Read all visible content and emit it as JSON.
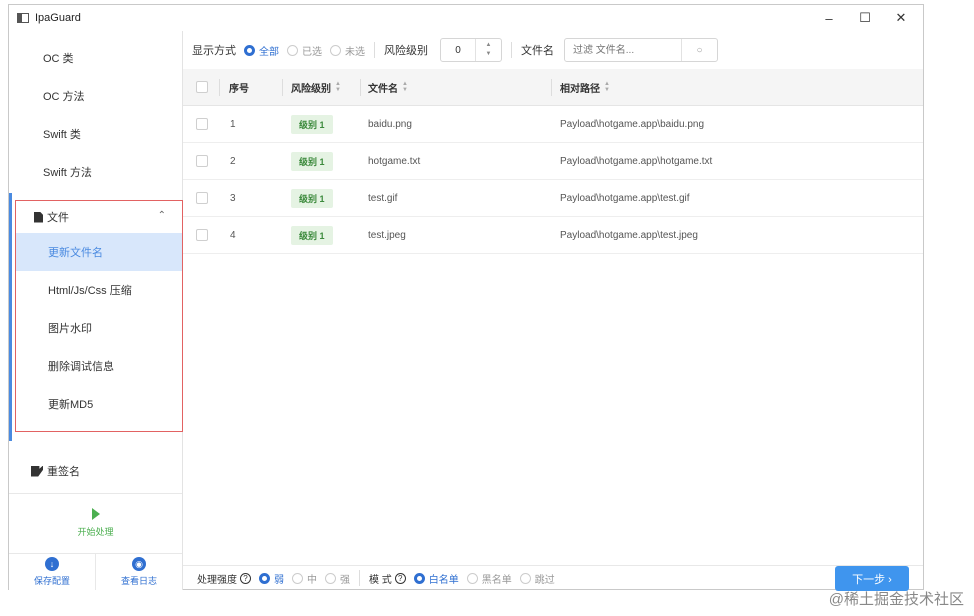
{
  "window": {
    "title": "IpaGuard",
    "min": "–",
    "max": "☐",
    "close": "✕"
  },
  "sidebar": {
    "items": [
      {
        "label": "OC 类"
      },
      {
        "label": "OC 方法"
      },
      {
        "label": "Swift 类"
      },
      {
        "label": "Swift 方法"
      }
    ],
    "group": {
      "label": "文件",
      "chevron": "⌃",
      "subitems": [
        {
          "label": "更新文件名",
          "active": true
        },
        {
          "label": "Html/Js/Css 压缩"
        },
        {
          "label": "图片水印"
        },
        {
          "label": "删除调试信息"
        },
        {
          "label": "更新MD5"
        }
      ]
    },
    "resign": "重签名",
    "start": "开始处理",
    "save_config": "保存配置",
    "view_log": "查看日志"
  },
  "toolbar": {
    "display_mode": "显示方式",
    "options": [
      "全部",
      "已选",
      "未选"
    ],
    "selected": "全部",
    "risk_level": "风险级别",
    "risk_value": "0",
    "filename_label": "文件名",
    "search_placeholder": "过滤 文件名..."
  },
  "table": {
    "headers": [
      "序号",
      "风险级别",
      "文件名",
      "相对路径"
    ],
    "rows": [
      {
        "index": "1",
        "risk": "级别 1",
        "name": "baidu.png",
        "path": "Payload\\hotgame.app\\baidu.png"
      },
      {
        "index": "2",
        "risk": "级别 1",
        "name": "hotgame.txt",
        "path": "Payload\\hotgame.app\\hotgame.txt"
      },
      {
        "index": "3",
        "risk": "级别 1",
        "name": "test.gif",
        "path": "Payload\\hotgame.app\\test.gif"
      },
      {
        "index": "4",
        "risk": "级别 1",
        "name": "test.jpeg",
        "path": "Payload\\hotgame.app\\test.jpeg"
      }
    ]
  },
  "footer": {
    "strength_label": "处理强度",
    "strength_options": [
      "弱",
      "中",
      "强"
    ],
    "strength_selected": "弱",
    "mode_label": "模 式",
    "mode_options": [
      "白名单",
      "黑名单",
      "跳过"
    ],
    "mode_selected": "白名单",
    "next": "下一步 ›"
  },
  "watermark": "@稀土掘金技术社区",
  "colors": {
    "accent": "#2f6fd1",
    "next_button": "#3f95ee",
    "start": "#4caf50",
    "group_border": "#e26262"
  }
}
